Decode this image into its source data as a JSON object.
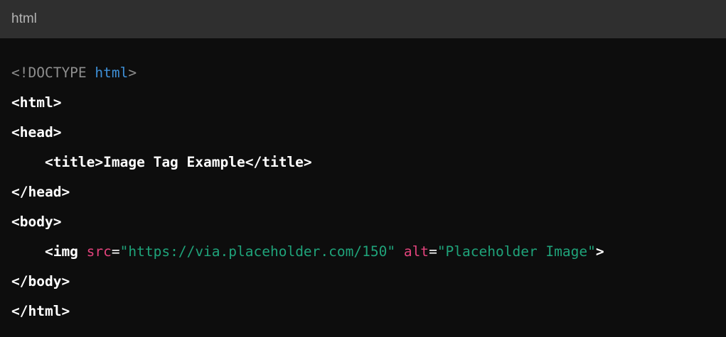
{
  "header": {
    "language": "html"
  },
  "code": {
    "lines": [
      [
        {
          "t": "<!DOCTYPE ",
          "c": "doctype"
        },
        {
          "t": "html",
          "c": "keyword"
        },
        {
          "t": ">",
          "c": "doctype"
        }
      ],
      [
        {
          "t": "<html>",
          "c": "tag"
        }
      ],
      [
        {
          "t": "<head>",
          "c": "tag"
        }
      ],
      [
        {
          "t": "    <title>",
          "c": "tag"
        },
        {
          "t": "Image Tag Example",
          "c": "text"
        },
        {
          "t": "</title>",
          "c": "tag"
        }
      ],
      [
        {
          "t": "</head>",
          "c": "tag"
        }
      ],
      [
        {
          "t": "<body>",
          "c": "tag"
        }
      ],
      [
        {
          "t": "    <img ",
          "c": "tag"
        },
        {
          "t": "src",
          "c": "attr"
        },
        {
          "t": "=",
          "c": "eq"
        },
        {
          "t": "\"https://via.placeholder.com/150\"",
          "c": "string"
        },
        {
          "t": " ",
          "c": "eq"
        },
        {
          "t": "alt",
          "c": "attr"
        },
        {
          "t": "=",
          "c": "eq"
        },
        {
          "t": "\"Placeholder Image\"",
          "c": "string"
        },
        {
          "t": ">",
          "c": "tag"
        }
      ],
      [
        {
          "t": "</body>",
          "c": "tag"
        }
      ],
      [
        {
          "t": "</html>",
          "c": "tag"
        }
      ]
    ]
  }
}
